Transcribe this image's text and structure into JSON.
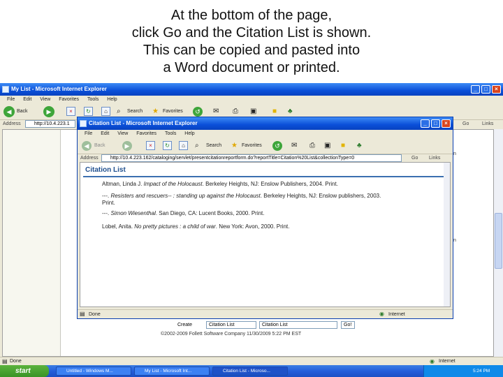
{
  "slide": {
    "lines": [
      "At the bottom of the page,",
      "click Go and the Citation List is shown.",
      "This can be copied and pasted into",
      "a Word document or printed."
    ]
  },
  "outer": {
    "title": "My List - Microsoft Internet Explorer",
    "menu": [
      "File",
      "Edit",
      "View",
      "Favorites",
      "Tools",
      "Help"
    ],
    "toolbar": {
      "back": "Back",
      "search": "Search",
      "favorites": "Favorites"
    },
    "address_label": "Address",
    "address": "http://10.4.223.1",
    "go": "Go",
    "links": "Links",
    "status": "Done",
    "zone": "Internet",
    "footer_text": "©2002-2009 Follett Software Company     11/30/2009 5:22 PM EST",
    "create_label": "Create",
    "create_value": "Citation List",
    "format_value": "Citation List",
    "go_button": "Go!",
    "right_bits": [
      "n",
      "n"
    ]
  },
  "popup": {
    "title": "Citation List - Microsoft Internet Explorer",
    "menu": [
      "File",
      "Edit",
      "View",
      "Favorites",
      "Tools",
      "Help"
    ],
    "toolbar": {
      "back": "Back",
      "search": "Search",
      "favorites": "Favorites"
    },
    "address_label": "Address",
    "address": "http://10.4.223.162/cataloging/servlet/presentcitationreportform.do?reportTitle=Citation%20List&collectionType=0",
    "go": "Go",
    "links": "Links",
    "status": "Done",
    "zone": "Internet",
    "heading": "Citation List",
    "citations": [
      {
        "pre": "Altman, Linda J. ",
        "title": "Impact of the Holocaust",
        "post": ". Berkeley Heights, NJ: Enslow Publishers, 2004. Print."
      },
      {
        "pre": "---. ",
        "title": "Resisters and rescuers-- : standing up against the Holocaust",
        "post": ". Berkeley Heights, NJ: Enslow publishers, 2003. Print."
      },
      {
        "pre": "---. ",
        "title": "Simon Wiesenthal",
        "post": ". San Diego, CA: Lucent Books, 2000. Print."
      },
      {
        "pre": "Lobel, Anita. ",
        "title": "No pretty pictures : a child of war",
        "post": ". New York: Avon, 2000. Print."
      }
    ]
  },
  "taskbar": {
    "start": "start",
    "tasks": [
      "Untitled - Windows M...",
      "My List - Microsoft Int...",
      "Citation List - Microso..."
    ],
    "clock": "5:24 PM"
  }
}
